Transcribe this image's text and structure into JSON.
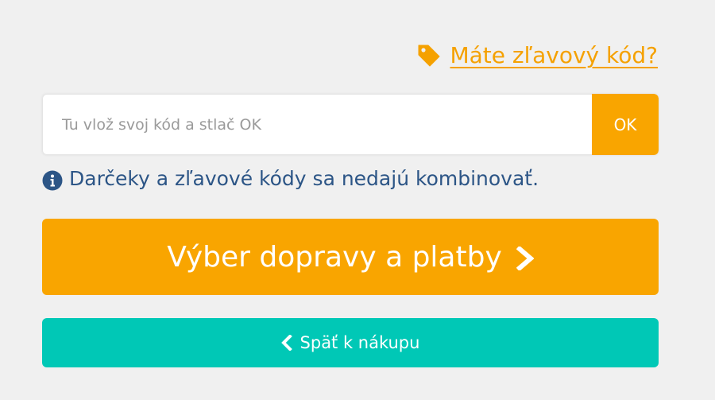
{
  "promo": {
    "link_text": "Máte zľavový kód?",
    "icon": "tag-icon"
  },
  "code_form": {
    "placeholder": "Tu vlož svoj kód a stlač OK",
    "value": "",
    "ok_label": "OK"
  },
  "info": {
    "icon": "info-icon",
    "text": "Darčeky a zľavové kódy sa nedajú kombinovať."
  },
  "actions": {
    "next_label": "Výber dopravy a platby",
    "next_icon": "chevron-right-icon",
    "back_label": "Späť k nákupu",
    "back_icon": "chevron-left-icon"
  },
  "colors": {
    "accent_orange": "#f9a500",
    "teal": "#00c8b6",
    "info_blue": "#2c5586",
    "background": "#f0f0f0"
  }
}
